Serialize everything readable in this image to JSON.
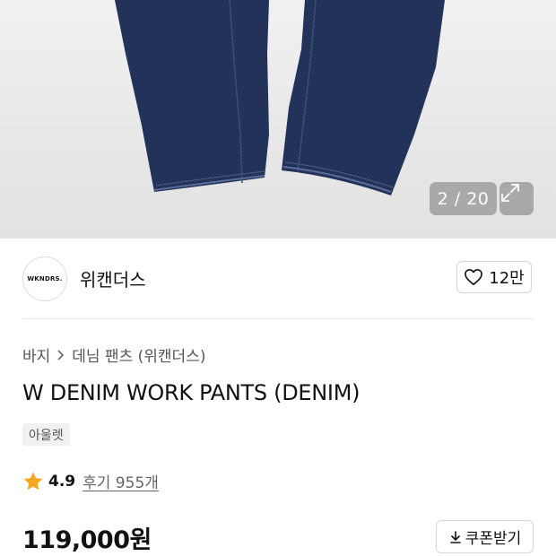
{
  "gallery": {
    "counter": "2 / 20",
    "expand_icon": "expand-icon"
  },
  "brand": {
    "logo_text": "WKNDRS.",
    "name": "위캔더스",
    "like_icon": "heart-icon",
    "like_count": "12만"
  },
  "breadcrumb": {
    "category": "바지",
    "subcategory": "데님 팬츠 (위캔더스)"
  },
  "product": {
    "title": "W DENIM WORK PANTS (DENIM)",
    "tag": "아울렛",
    "rating": "4.9",
    "reviews": "후기 955개",
    "price": "119,000원"
  },
  "coupon": {
    "label": "쿠폰받기",
    "icon": "download-icon"
  },
  "colors": {
    "star": "#f5a623",
    "denim": "#1e2d52"
  }
}
